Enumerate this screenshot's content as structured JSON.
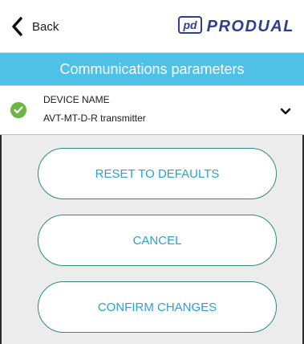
{
  "header": {
    "back_label": "Back",
    "back_icon": "chevron-left-icon",
    "logo_icon": "pd-logo-icon",
    "logo_mark": "pd",
    "logo_text": "PRODUAL"
  },
  "title_bar": {
    "title": "Communications parameters"
  },
  "device": {
    "label": "DEVICE NAME",
    "value": "AVT-MT-D-R transmitter",
    "status_icon": "check-circle-icon",
    "expand_icon": "chevron-down-icon"
  },
  "actions": {
    "reset_label": "RESET TO DEFAULTS",
    "cancel_label": "CANCEL",
    "confirm_label": "CONFIRM CHANGES"
  },
  "colors": {
    "accent": "#4fc1e6",
    "button_text": "#29a1d4",
    "button_border": "#2f8a7c",
    "status_ok": "#6ab544",
    "brand": "#2f3f8a",
    "background": "#ececec"
  }
}
